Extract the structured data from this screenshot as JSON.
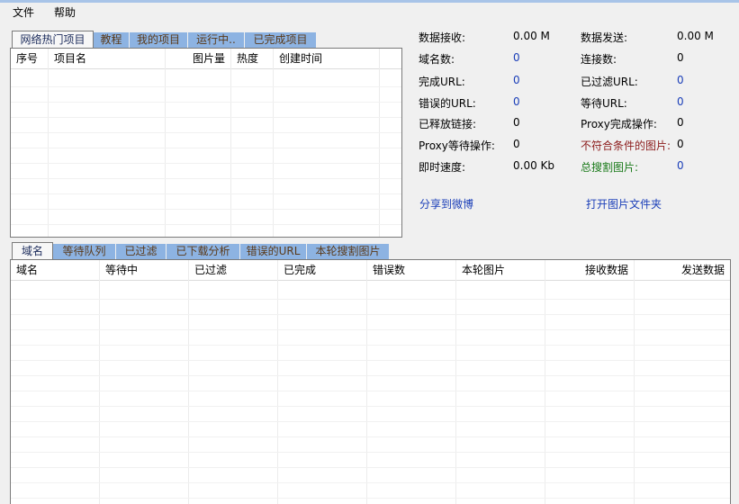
{
  "menu": {
    "file": "文件",
    "help": "帮助"
  },
  "top_tabs": [
    "网络热门项目",
    "教程",
    "我的项目",
    "运行中..",
    "已完成项目"
  ],
  "project_table": {
    "columns": [
      "序号",
      "项目名",
      "图片量",
      "热度",
      "创建时间"
    ]
  },
  "stats": {
    "data_received": {
      "label": "数据接收:",
      "value": "0.00 M"
    },
    "data_sent": {
      "label": "数据发送:",
      "value": "0.00 M"
    },
    "domains": {
      "label": "域名数:",
      "value": "0"
    },
    "connections": {
      "label": "连接数:",
      "value": "0"
    },
    "completed_url": {
      "label": "完成URL:",
      "value": "0"
    },
    "filtered_url": {
      "label": "已过滤URL:",
      "value": "0"
    },
    "error_url": {
      "label": "错误的URL:",
      "value": "0"
    },
    "waiting_url": {
      "label": "等待URL:",
      "value": "0"
    },
    "released_links": {
      "label": "已释放链接:",
      "value": "0"
    },
    "proxy_completed": {
      "label": "Proxy完成操作:",
      "value": "0"
    },
    "proxy_waiting": {
      "label": "Proxy等待操作:",
      "value": "0"
    },
    "unqualified_images": {
      "label": "不符合条件的图片:",
      "value": "0"
    },
    "instant_speed": {
      "label": "即时速度:",
      "value": "0.00 Kb"
    },
    "total_images": {
      "label": "总搜割图片:",
      "value": "0"
    }
  },
  "links": {
    "share_weibo": "分享到微博",
    "open_folder": "打开图片文件夹"
  },
  "bottom_tabs": [
    "域名",
    "等待队列",
    "已过滤",
    "已下载分析",
    "错误的URL",
    "本轮搜割图片"
  ],
  "domain_table": {
    "columns": [
      "域名",
      "等待中",
      "已过滤",
      "已完成",
      "错误数",
      "本轮图片",
      "接收数据",
      "发送数据"
    ]
  },
  "colors": {
    "tab_blue": "#8db3e2",
    "accent_blue": "#1a3eb8",
    "warn_red": "#8b1a1a",
    "ok_green": "#1a7a1a"
  }
}
